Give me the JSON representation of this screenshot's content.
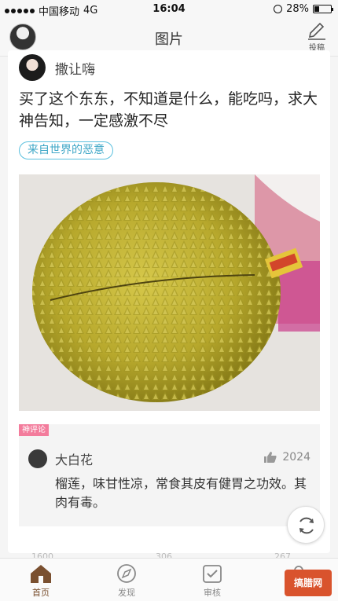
{
  "status_bar": {
    "carrier": "中国移动",
    "network": "4G",
    "time": "16:04",
    "battery_text": "28%",
    "battery_level": 0.28
  },
  "nav": {
    "title": "图片",
    "post_label": "投稿",
    "page_count": 5,
    "active_page": 2
  },
  "post": {
    "author": "撒让嗨",
    "text": "买了这个东东，不知道是什么，能吃吗，求大神告知，一定感激不尽",
    "tag": "来自世界的恶意",
    "image_icon": "durian-photo"
  },
  "comment": {
    "badge": "神评论",
    "name": "大白花",
    "likes": "2024",
    "text": "榴莲，味甘性凉，常食其皮有健胃之功效。其肉有毒。"
  },
  "partial_actions": [
    "1600",
    "306",
    "267"
  ],
  "tabs": [
    {
      "label": "首页",
      "icon": "home-icon",
      "active": true
    },
    {
      "label": "发现",
      "icon": "compass-icon",
      "active": false
    },
    {
      "label": "审核",
      "icon": "check-icon",
      "active": false
    },
    {
      "label": "",
      "icon": "profile-icon",
      "active": false
    }
  ],
  "watermark": "搞腊网",
  "colors": {
    "accent": "#f08a5a",
    "tag": "#3fa7c7",
    "badge": "#f37c9c"
  }
}
